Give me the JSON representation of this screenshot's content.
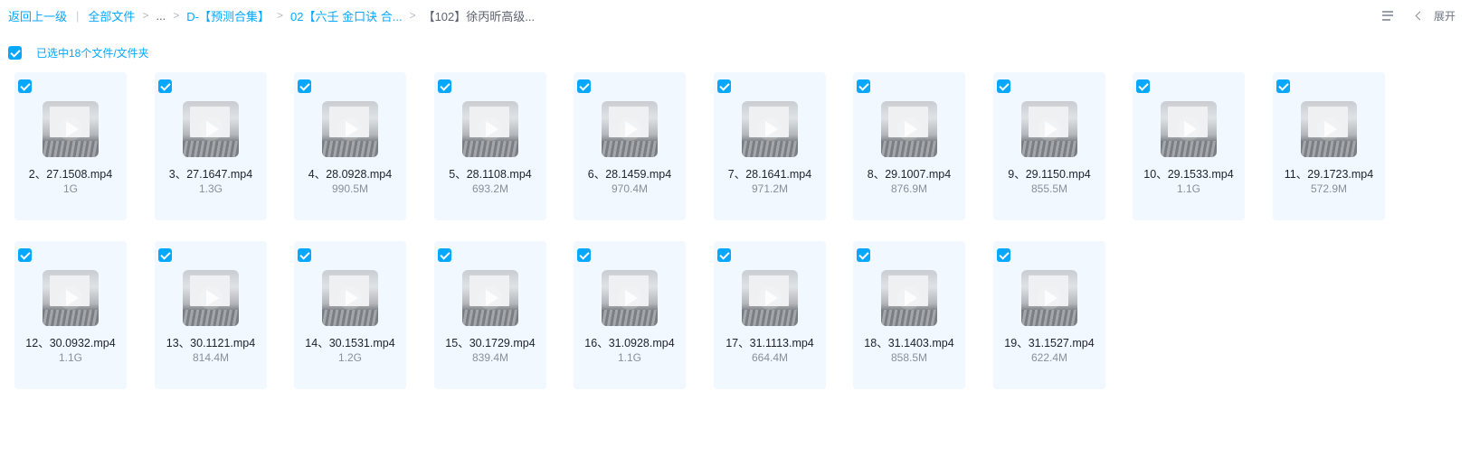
{
  "breadcrumb": {
    "back": "返回上一级",
    "all_files": "全部文件",
    "ellipsis": "...",
    "folder1": "D-【预测合集】",
    "folder2": "02【六壬 金口诀 合...",
    "current": "【102】徐丙昕高级..."
  },
  "toolbar": {
    "list_icon": "list-view-icon",
    "chevron_icon": "chevron-left-icon",
    "expand_label": "展开"
  },
  "selection": {
    "label": "已选中18个文件/文件夹",
    "checked": true
  },
  "colors": {
    "accent": "#06a7ff",
    "card_bg": "#f1f8ff"
  },
  "files": [
    {
      "name": "2、27.1508.mp4",
      "size": "1G"
    },
    {
      "name": "3、27.1647.mp4",
      "size": "1.3G"
    },
    {
      "name": "4、28.0928.mp4",
      "size": "990.5M"
    },
    {
      "name": "5、28.1108.mp4",
      "size": "693.2M"
    },
    {
      "name": "6、28.1459.mp4",
      "size": "970.4M"
    },
    {
      "name": "7、28.1641.mp4",
      "size": "971.2M"
    },
    {
      "name": "8、29.1007.mp4",
      "size": "876.9M"
    },
    {
      "name": "9、29.1150.mp4",
      "size": "855.5M"
    },
    {
      "name": "10、29.1533.mp4",
      "size": "1.1G"
    },
    {
      "name": "11、29.1723.mp4",
      "size": "572.9M"
    },
    {
      "name": "12、30.0932.mp4",
      "size": "1.1G"
    },
    {
      "name": "13、30.1121.mp4",
      "size": "814.4M"
    },
    {
      "name": "14、30.1531.mp4",
      "size": "1.2G"
    },
    {
      "name": "15、30.1729.mp4",
      "size": "839.4M"
    },
    {
      "name": "16、31.0928.mp4",
      "size": "1.1G"
    },
    {
      "name": "17、31.1113.mp4",
      "size": "664.4M"
    },
    {
      "name": "18、31.1403.mp4",
      "size": "858.5M"
    },
    {
      "name": "19、31.1527.mp4",
      "size": "622.4M"
    }
  ]
}
